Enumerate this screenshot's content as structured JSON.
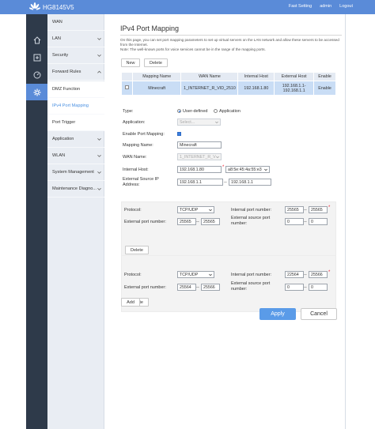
{
  "header": {
    "product": "HG8145V5",
    "links": [
      "Fast Setting",
      "admin",
      "Logout"
    ]
  },
  "nav": {
    "items": [
      {
        "label": "WAN",
        "expandable": false
      },
      {
        "label": "LAN",
        "expandable": true
      },
      {
        "label": "Security",
        "expandable": true
      },
      {
        "label": "Forward Rules",
        "expandable": true
      }
    ],
    "sub_items": [
      {
        "label": "DMZ Function"
      },
      {
        "label": "IPv4 Port Mapping"
      },
      {
        "label": "Port Trigger"
      }
    ],
    "more_items": [
      {
        "label": "Application",
        "expandable": true
      },
      {
        "label": "WLAN",
        "expandable": true
      },
      {
        "label": "System Management",
        "expandable": true
      },
      {
        "label": "Maintenance Diagno...",
        "expandable": true
      }
    ]
  },
  "page": {
    "title": "IPv4 Port Mapping",
    "description": "On this page, you can set port mapping parameters to set up virtual servers on the LAN network and allow these servers to be accessed from the Internet.\nNote: The well-known ports for voice services cannot be in the range of the mapping ports.",
    "new_label": "New",
    "delete_label": "Delete"
  },
  "table": {
    "headers": [
      "",
      "Mapping Name",
      "WAN Name",
      "Internal Host",
      "External Host",
      "Enable"
    ],
    "rows": [
      {
        "name": "Minecraft",
        "wan": "1_INTERNET_R_VID_2510",
        "internal": "192.168.1.80",
        "external": "192.168.1.1-192.168.1.1",
        "enable": "Enable"
      }
    ]
  },
  "form": {
    "type_label": "Type:",
    "type_user": "User-defined",
    "type_app": "Application",
    "application_label": "Application:",
    "application_value": "Select...",
    "enable_label": "Enable Port Mapping:",
    "mapping_name_label": "Mapping Name:",
    "mapping_name_value": "Minecraft",
    "wan_label": "WAN Name:",
    "wan_value": "1_INTERNET_R_V",
    "internal_host_label": "Internal Host:",
    "internal_host_value": "192.168.1.80",
    "mac_value": "a8:5e:45:4a:55:e3",
    "ext_src_label": "External Source IP Address:",
    "ext_src_start": "192.168.1.1",
    "ext_src_end": "192.168.1.1",
    "range_sep": "--",
    "required_mark": "*"
  },
  "rules": [
    {
      "protocol_label": "Protocol:",
      "protocol": "TCP/UDP",
      "int_port_label": "Internal port number:",
      "int_start": "25565",
      "int_end": "25565",
      "ext_port_label": "External port number:",
      "ext_start": "25565",
      "ext_end": "25565",
      "ext_src_port_label": "External source port number:",
      "src_start": "0",
      "src_end": "0",
      "delete_label": "Delete"
    },
    {
      "protocol_label": "Protocol:",
      "protocol": "TCP/UDP",
      "int_port_label": "Internal port number:",
      "int_start": "22564",
      "int_end": "25566",
      "ext_port_label": "External port number:",
      "ext_start": "25564",
      "ext_end": "25566",
      "ext_src_port_label": "External source port number:",
      "src_start": "0",
      "src_end": "0",
      "delete_label": "Delete"
    }
  ],
  "add_label": "Add",
  "apply_label": "Apply",
  "cancel_label": "Cancel",
  "colors": {
    "accent": "#5a8bd8",
    "sidebar": "#2e3a4a",
    "selected_row": "#c9ddf5"
  }
}
